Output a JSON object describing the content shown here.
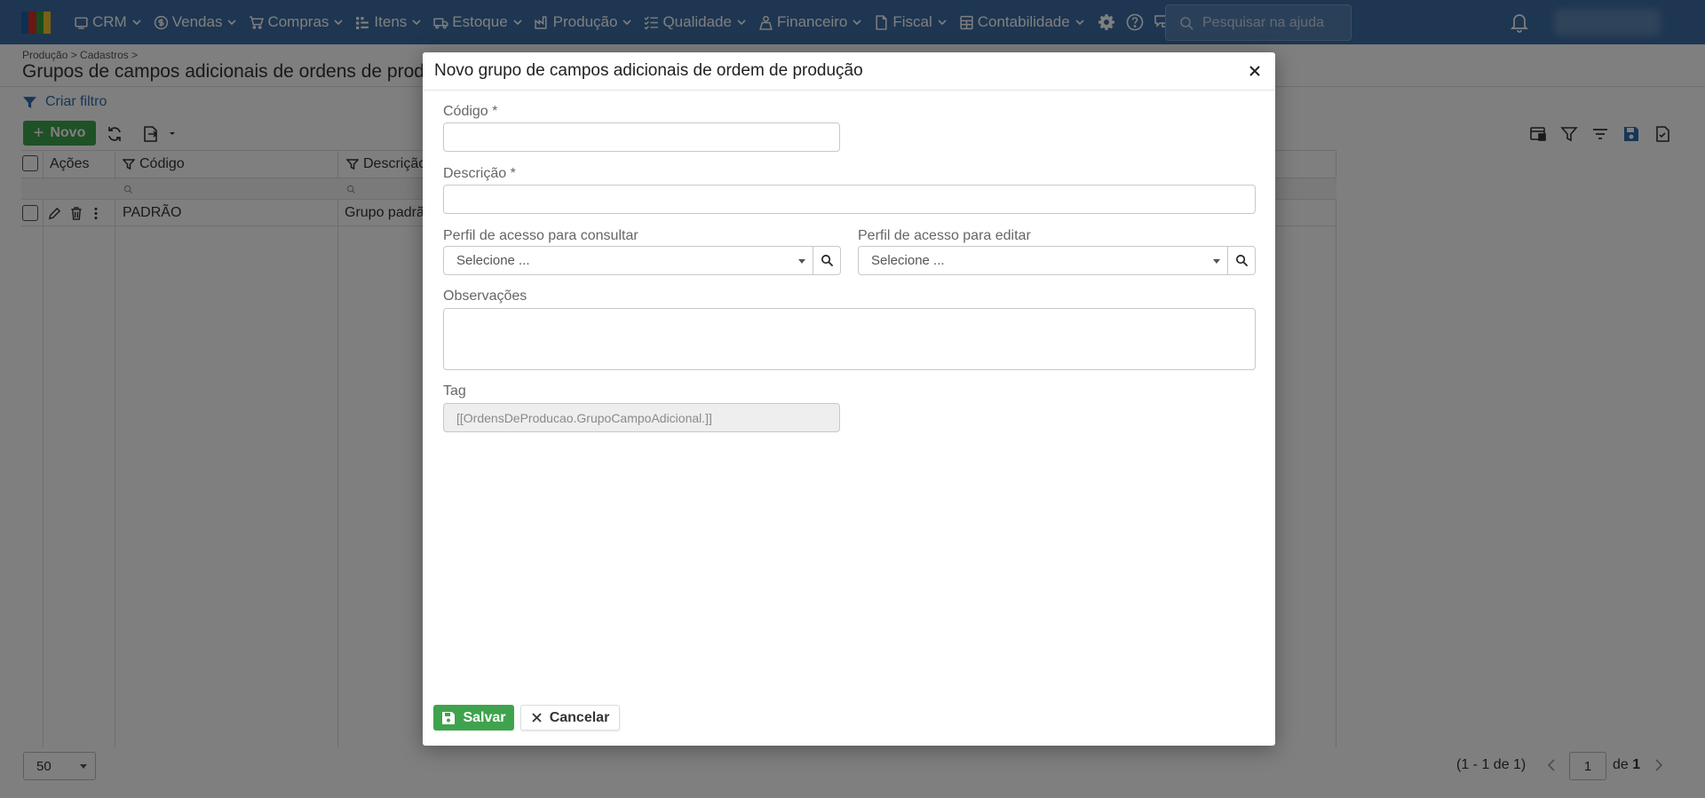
{
  "topbar": {
    "nav": [
      {
        "label": "CRM",
        "icon": "crm-icon"
      },
      {
        "label": "Vendas",
        "icon": "dollar-icon"
      },
      {
        "label": "Compras",
        "icon": "cart-icon"
      },
      {
        "label": "Itens",
        "icon": "items-icon"
      },
      {
        "label": "Estoque",
        "icon": "truck-icon"
      },
      {
        "label": "Produção",
        "icon": "factory-icon"
      },
      {
        "label": "Qualidade",
        "icon": "checklist-icon"
      },
      {
        "label": "Financeiro",
        "icon": "money-icon"
      },
      {
        "label": "Fiscal",
        "icon": "document-icon"
      },
      {
        "label": "Contabilidade",
        "icon": "calculator-icon"
      }
    ],
    "search_placeholder": "Pesquisar na ajuda",
    "brand_color": "#3d6da3"
  },
  "page": {
    "breadcrumb": "Produção > Cadastros >",
    "title": "Grupos de campos adicionais de ordens de produção",
    "filter_link": "Criar filtro",
    "new_button": "Novo"
  },
  "grid": {
    "columns": [
      "Ações",
      "Código",
      "Descrição"
    ],
    "rows": [
      {
        "codigo": "PADRÃO",
        "descricao": "Grupo padrão"
      }
    ]
  },
  "pager": {
    "page_size": "50",
    "info": "(1 - 1 de 1)",
    "page": "1",
    "of_label": "de",
    "total_pages": "1"
  },
  "modal": {
    "title": "Novo grupo de campos adicionais de ordem de produção",
    "fields": {
      "codigo_label": "Código *",
      "codigo_value": "",
      "descricao_label": "Descrição *",
      "descricao_value": "",
      "perfil_consultar_label": "Perfil de acesso para consultar",
      "perfil_consultar_value": "Selecione ...",
      "perfil_editar_label": "Perfil de acesso para editar",
      "perfil_editar_value": "Selecione ...",
      "observacoes_label": "Observações",
      "tag_label": "Tag",
      "tag_value": "[[OrdensDeProducao.GrupoCampoAdicional.]]"
    },
    "save_button": "Salvar",
    "cancel_button": "Cancelar",
    "accent_color": "#3fa34d"
  }
}
